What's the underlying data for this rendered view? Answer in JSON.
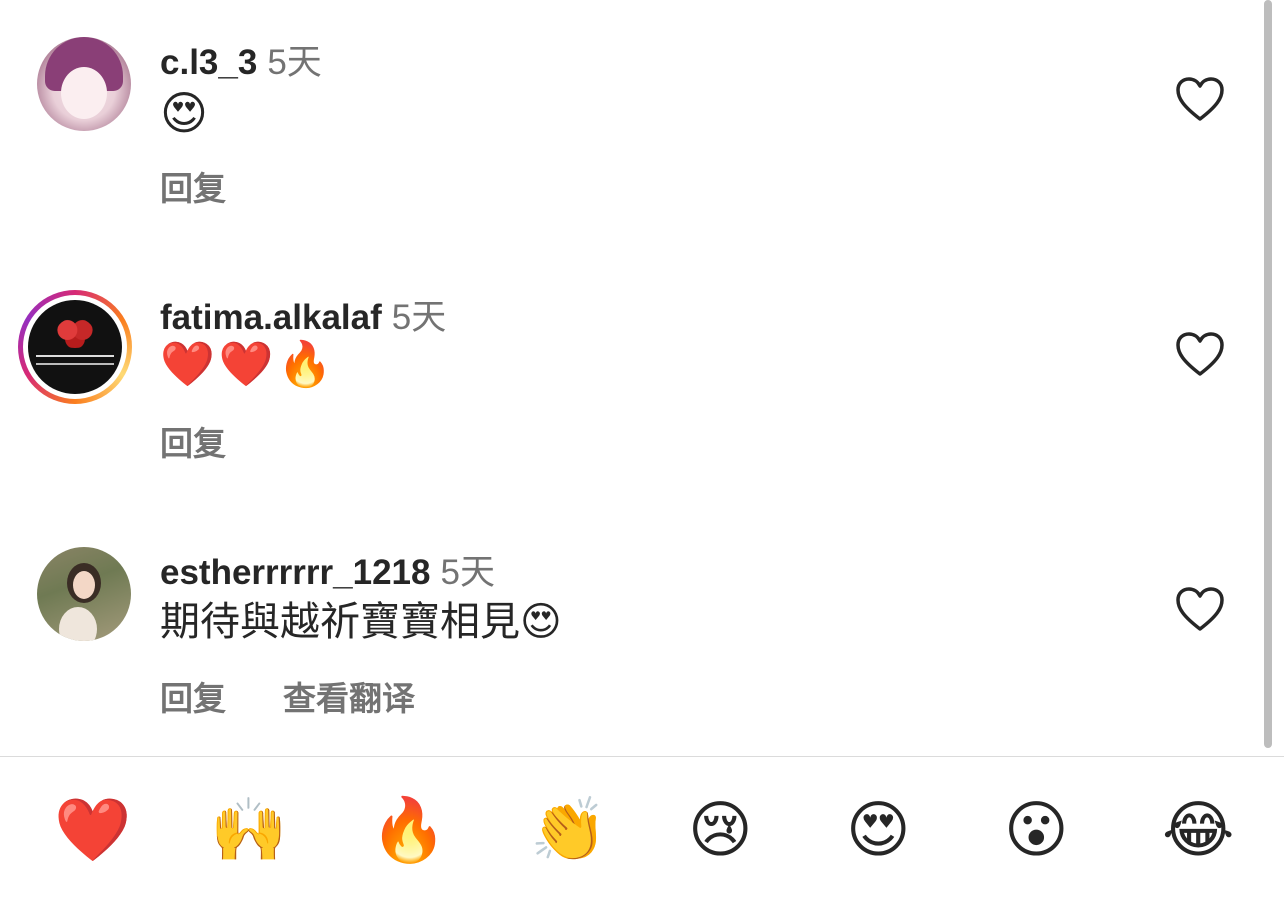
{
  "comments": [
    {
      "username": "c.l3_3",
      "time": "5天",
      "text": "😍",
      "reply_label": "回复"
    },
    {
      "username": "fatima.alkalaf",
      "time": "5天",
      "text": "❤️❤️🔥",
      "reply_label": "回复"
    },
    {
      "username": "estherrrrrr_1218",
      "time": "5天",
      "text": "期待與越祈寶寶相見😍",
      "reply_label": "回复",
      "translate_label": "查看翻译"
    }
  ],
  "quick_reactions": [
    "❤️",
    "🙌",
    "🔥",
    "👏",
    "😢",
    "😍",
    "😮",
    "😂"
  ],
  "icons": {
    "like": "heart-outline-icon"
  },
  "colors": {
    "story_ring": [
      "#d62976",
      "#fa7e1e",
      "#feda75",
      "#962fbf"
    ],
    "secondary_text": "#737373",
    "primary_text": "#262626"
  }
}
